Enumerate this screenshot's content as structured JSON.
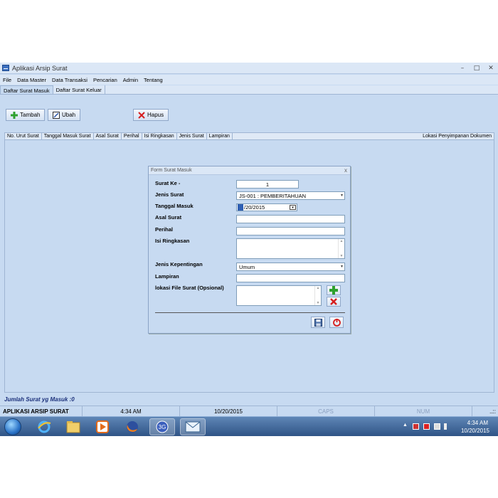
{
  "window": {
    "title": "Aplikasi Arsip Surat",
    "controls": [
      "–",
      "□",
      "✕"
    ]
  },
  "menu": [
    "File",
    "Data Master",
    "Data Transaksi",
    "Pencarian",
    "Admin",
    "Tentang"
  ],
  "tabs": [
    "Daftar Surat Masuk",
    "Daftar Surat Keluar"
  ],
  "toolbar": {
    "add_label": "Tambah",
    "edit_label": "Ubah",
    "delete_label": "Hapus"
  },
  "grid": {
    "columns": [
      "No. Urut Surat",
      "Tanggal Masuk Surat",
      "Asal Surat",
      "Perihal",
      "Isi Ringkasan",
      "Jenis Surat",
      "Lampiran"
    ],
    "last_column": "Lokasi Penyimpanan Dokumen"
  },
  "dialog": {
    "title": "Form Surat Masuk",
    "close": "x",
    "labels": {
      "surat_ke": "Surat Ke -",
      "jenis_surat": "Jenis Surat",
      "tanggal_masuk": "Tanggal Masuk",
      "asal_surat": "Asal Surat",
      "perihal": "Perihal",
      "isi_ringkasan": "Isi Ringkasan",
      "jenis_kepentingan": "Jenis Kepentingan",
      "lampiran": "Lampiran",
      "lokasi_file": "lokasi File  Surat (Opsional)"
    },
    "values": {
      "surat_ke": "1",
      "jenis_surat": "JS-001 : PEMBERITAHUAN",
      "tanggal_masuk": "/20/2015",
      "jenis_kepentingan": "Umum"
    }
  },
  "footer": {
    "count_text": "Jumlah Surat yg Masuk :0"
  },
  "statusbar": {
    "app_name": "APLIKASI ARSIP SURAT",
    "time": "4:34 AM",
    "date": "10/20/2015",
    "caps": "CAPS",
    "num": "NUM",
    "grip": "..::"
  },
  "taskbar": {
    "clock_time": "4:34 AM",
    "clock_date": "10/20/2015",
    "icons": [
      "internet-explorer-icon",
      "folder-icon",
      "media-player-icon",
      "firefox-icon",
      "3g-modem-icon",
      "mail-app-icon"
    ]
  },
  "colors": {
    "app_background": "#c7daf1",
    "taskbar": "#2f5486",
    "footer_text": "#1a2f7a"
  }
}
